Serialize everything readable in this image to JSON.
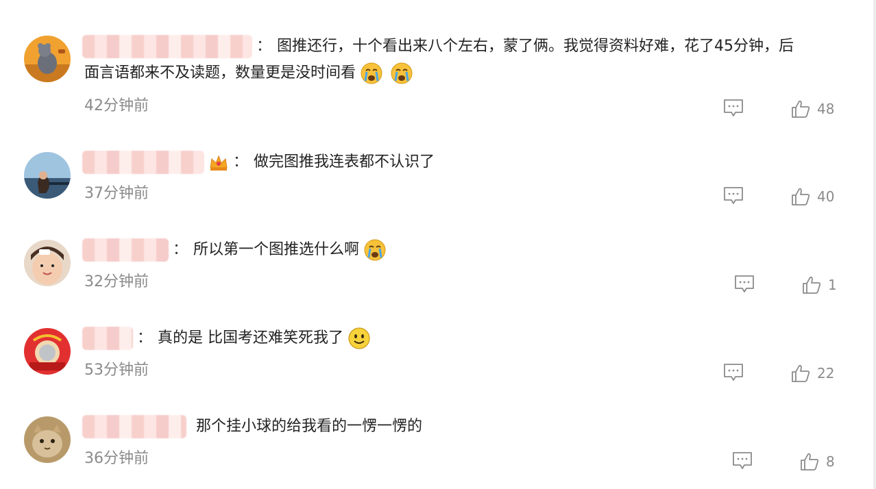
{
  "comments": [
    {
      "line1": "图推还行，十个看出来八个左右，蒙了俩。我觉得资料好难，花了45分钟，后",
      "line2": "面言语都来不及读题，数量更是没时间看",
      "time": "42分钟前",
      "likes": "48",
      "emojis": [
        "crying-face-icon",
        "crying-face-icon"
      ]
    },
    {
      "content": "做完图推我连表都不认识了",
      "time": "37分钟前",
      "likes": "40",
      "badge": "crown-icon"
    },
    {
      "content": "所以第一个图推选什么啊",
      "time": "32分钟前",
      "likes": "1",
      "emojis": [
        "crying-face-icon"
      ]
    },
    {
      "content": "真的是 比国考还难笑死我了",
      "time": "53分钟前",
      "likes": "22",
      "emojis": [
        "smile-face-icon"
      ]
    },
    {
      "content": "那个挂小球的给我看的一愣一愣的",
      "time": "36分钟前",
      "likes": "8"
    }
  ],
  "separator": "："
}
